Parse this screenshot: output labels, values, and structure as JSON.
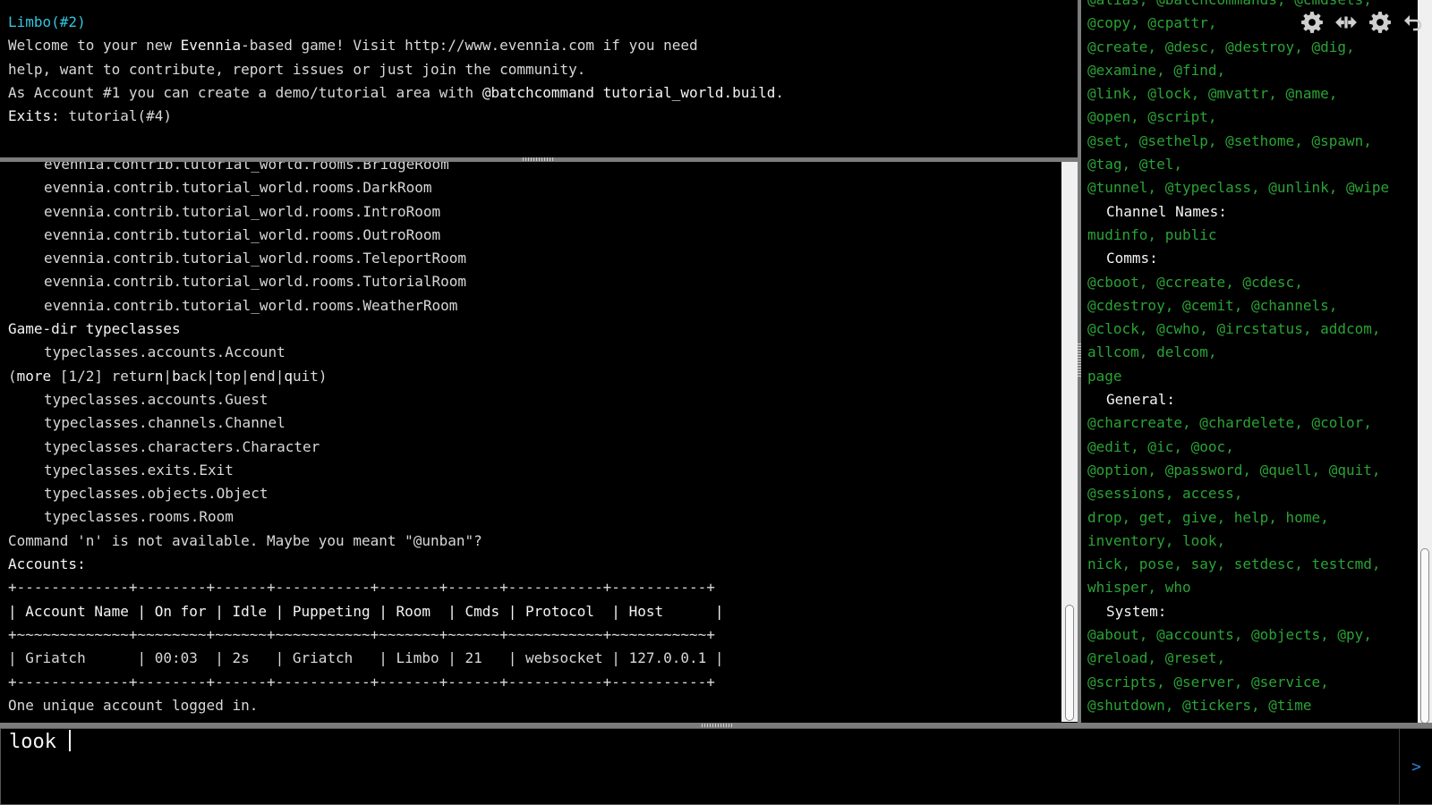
{
  "top_pane": {
    "room_name": "Limbo(#2)",
    "welcome_1a": "Welcome to your new ",
    "welcome_1b": "Evennia",
    "welcome_1c": "-based game! Visit http://www.evennia.com if you need",
    "welcome_2": "help, want to contribute, report issues or just join the community.",
    "welcome_3a": "As Account #1 you can create a demo/tutorial area with ",
    "welcome_3b": "@batchcommand tutorial_world.build",
    "welcome_3c": ".",
    "exits_label": "Exits:",
    "exits_value": " tutorial(#4)"
  },
  "log": {
    "contrib_rooms": [
      "evennia.contrib.tutorial_world.rooms.BridgeRoom",
      "evennia.contrib.tutorial_world.rooms.DarkRoom",
      "evennia.contrib.tutorial_world.rooms.IntroRoom",
      "evennia.contrib.tutorial_world.rooms.OutroRoom",
      "evennia.contrib.tutorial_world.rooms.TeleportRoom",
      "evennia.contrib.tutorial_world.rooms.TutorialRoom",
      "evennia.contrib.tutorial_world.rooms.WeatherRoom"
    ],
    "gamedir_heading": "Game-dir typeclasses",
    "gamedir_first": "typeclasses.accounts.Account",
    "more_prompt": {
      "open": "(",
      "more": "more",
      "page": " [1/2] ",
      "seg_1": "retur",
      "key_n": "n",
      "sep_1": "|",
      "key_b": "b",
      "seg_2": "ack|",
      "key_t": "t",
      "seg_3": "op|",
      "key_e": "e",
      "seg_4": "nd|",
      "key_q": "q",
      "seg_5": "uit)"
    },
    "gamedir_rest": [
      "typeclasses.accounts.Guest",
      "typeclasses.channels.Channel",
      "typeclasses.characters.Character",
      "typeclasses.exits.Exit",
      "typeclasses.objects.Object",
      "typeclasses.rooms.Room"
    ],
    "unknown_command": "Command 'n' is not available. Maybe you meant \"@unban\"?",
    "accounts_heading": "Accounts:",
    "table_border": "+-------------+--------+------+-----------+-------+------+-----------+-----------+",
    "table_header": "| Account Name | On for | Idle | Puppeting | Room  | Cmds | Protocol  | Host      |",
    "table_divider": "+~~~~~~~~~~~~~+~~~~~~~~+~~~~~~+~~~~~~~~~~~+~~~~~~~+~~~~~~+~~~~~~~~~~~+~~~~~~~~~~~+",
    "table_row": "| Griatch      | 00:03  | 2s   | Griatch   | Limbo | 21   | websocket | 127.0.0.1 |",
    "summary": "One unique account logged in."
  },
  "side_pane": {
    "lines": [
      {
        "kind": "cmd",
        "text": "@alias, @batchcommands, @cmdsets,"
      },
      {
        "kind": "cmd",
        "text": "@copy, @cpattr,"
      },
      {
        "kind": "cmd",
        "text": "@create, @desc, @destroy, @dig,"
      },
      {
        "kind": "cmd",
        "text": "@examine, @find,"
      },
      {
        "kind": "cmd",
        "text": "@link, @lock, @mvattr, @name,"
      },
      {
        "kind": "cmd",
        "text": "@open, @script,"
      },
      {
        "kind": "cmd",
        "text": "@set, @sethelp, @sethome, @spawn,"
      },
      {
        "kind": "cmd",
        "text": "@tag, @tel,"
      },
      {
        "kind": "cmd",
        "text": "@tunnel, @typeclass, @unlink, @wipe"
      },
      {
        "kind": "cat",
        "text": "Channel Names:"
      },
      {
        "kind": "cmd",
        "text": "mudinfo, public"
      },
      {
        "kind": "cat",
        "text": "Comms:"
      },
      {
        "kind": "cmd",
        "text": "@cboot, @ccreate, @cdesc,"
      },
      {
        "kind": "cmd",
        "text": "@cdestroy, @cemit, @channels,"
      },
      {
        "kind": "cmd",
        "text": "@clock, @cwho, @ircstatus, addcom,"
      },
      {
        "kind": "cmd",
        "text": "allcom, delcom,"
      },
      {
        "kind": "cmd",
        "text": "page"
      },
      {
        "kind": "cat",
        "text": "General:"
      },
      {
        "kind": "cmd",
        "text": "@charcreate, @chardelete, @color,"
      },
      {
        "kind": "cmd",
        "text": "@edit, @ic, @ooc,"
      },
      {
        "kind": "cmd",
        "text": "@option, @password, @quell, @quit,"
      },
      {
        "kind": "cmd",
        "text": "@sessions, access,"
      },
      {
        "kind": "cmd",
        "text": "drop, get, give, help, home,"
      },
      {
        "kind": "cmd",
        "text": "inventory, look,"
      },
      {
        "kind": "cmd",
        "text": "nick, pose, say, setdesc, testcmd,"
      },
      {
        "kind": "cmd",
        "text": "whisper, who"
      },
      {
        "kind": "cat",
        "text": "System:"
      },
      {
        "kind": "cmd",
        "text": "@about, @accounts, @objects, @py,"
      },
      {
        "kind": "cmd",
        "text": "@reload, @reset,"
      },
      {
        "kind": "cmd",
        "text": "@scripts, @server, @service,"
      },
      {
        "kind": "cmd",
        "text": "@shutdown, @tickers, @time"
      }
    ]
  },
  "toolbar": {
    "icons": [
      "gear-icon",
      "resize-horizontal-icon",
      "gear-icon",
      "undo-icon"
    ]
  },
  "input": {
    "value": "look ",
    "send_glyph": ">"
  },
  "colors": {
    "room_name": "#33c4e0",
    "help_commands": "#2aa335",
    "send_button": "#2f7dd8"
  }
}
